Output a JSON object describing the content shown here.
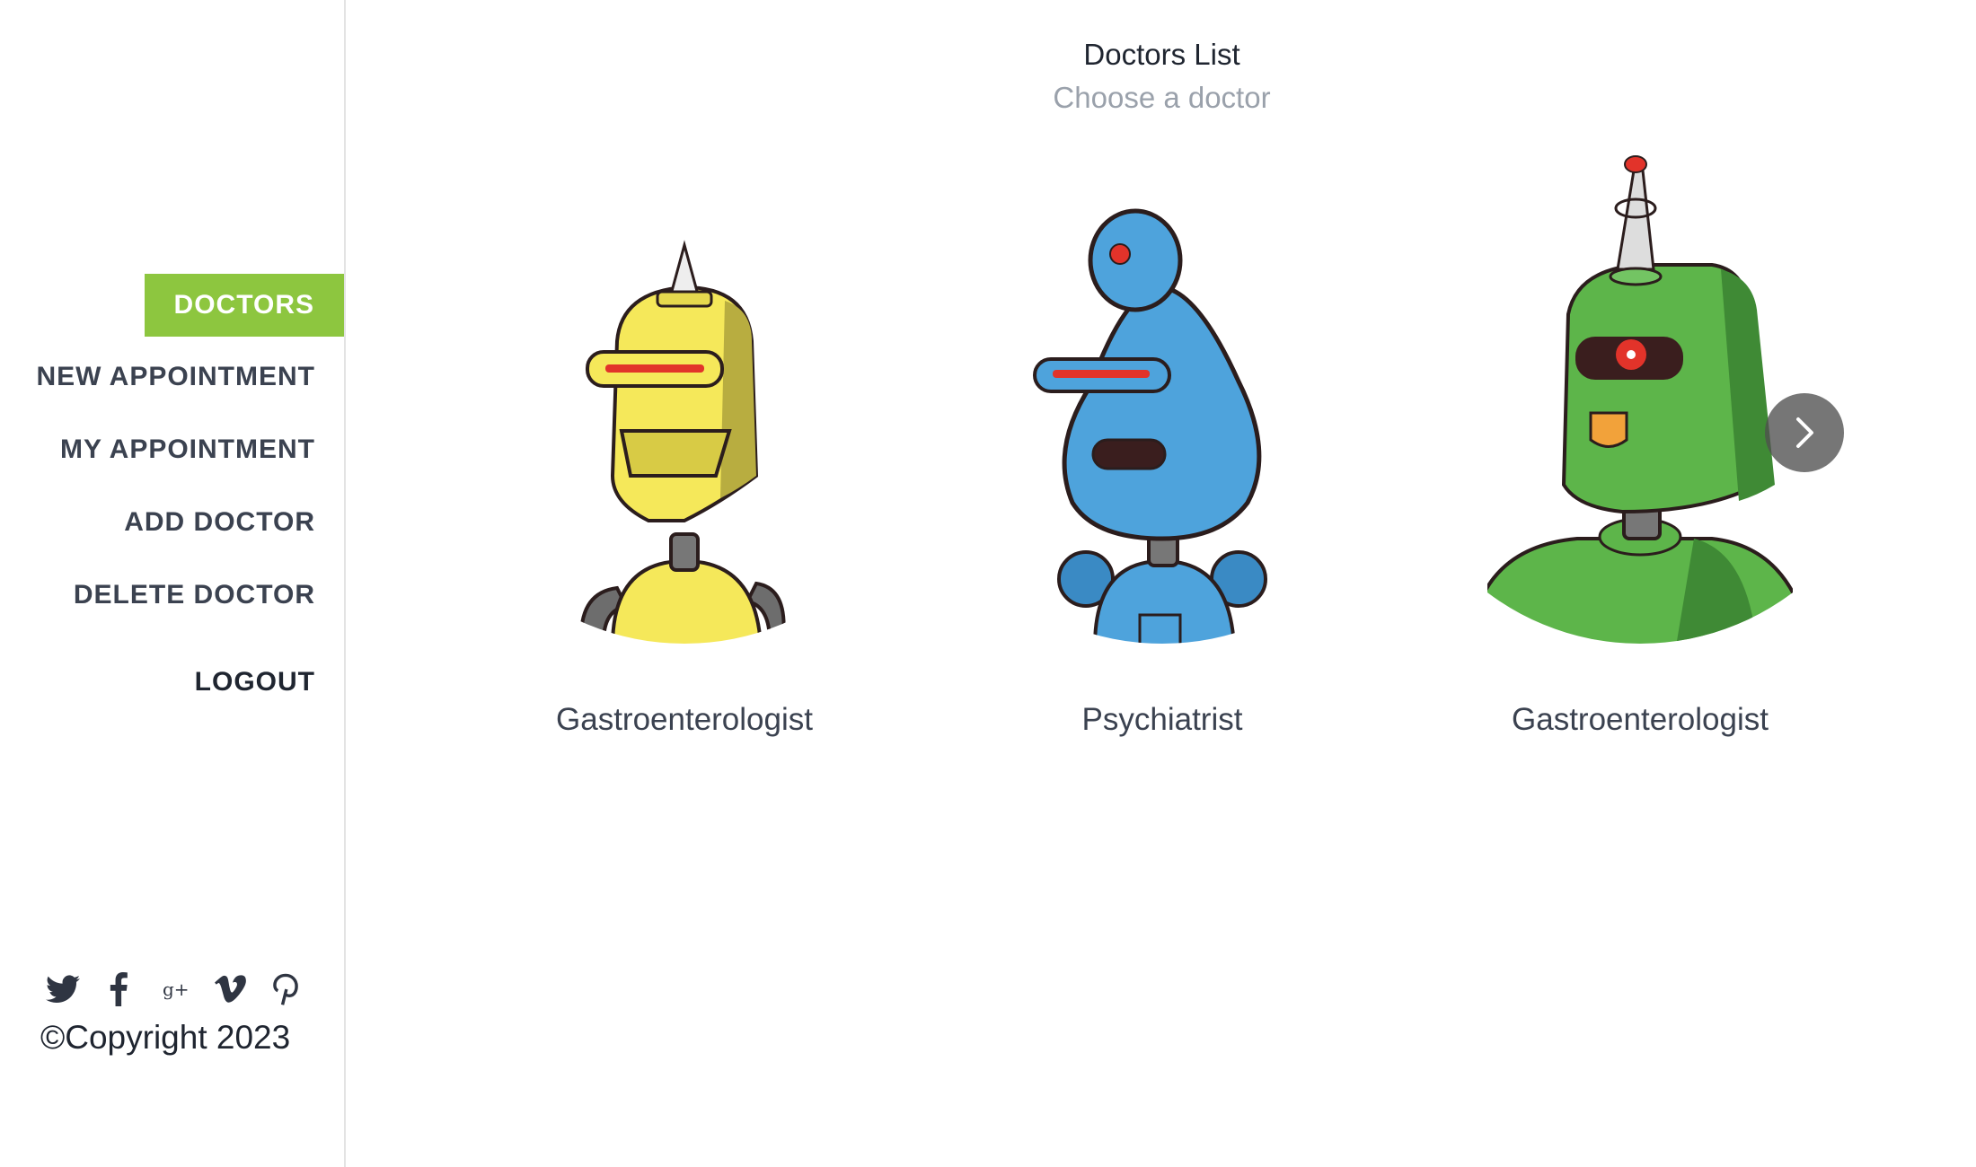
{
  "sidebar": {
    "nav": [
      {
        "label": "DOCTORS",
        "active": true
      },
      {
        "label": "NEW APPOINTMENT",
        "active": false
      },
      {
        "label": "MY APPOINTMENT",
        "active": false
      },
      {
        "label": "ADD DOCTOR",
        "active": false
      },
      {
        "label": "DELETE DOCTOR",
        "active": false
      }
    ],
    "logout_label": "LOGOUT",
    "social_icons": [
      "twitter-icon",
      "facebook-icon",
      "google-plus-icon",
      "vimeo-icon",
      "pinterest-icon"
    ],
    "copyright": "©Copyright 2023",
    "accent_color": "#8dc63f"
  },
  "main": {
    "title": "Doctors List",
    "subtitle": "Choose a doctor",
    "doctors": [
      {
        "specialty": "Gastroenterologist",
        "avatar": "yellow-robot",
        "color": "#f5e85a"
      },
      {
        "specialty": "Psychiatrist",
        "avatar": "blue-robot",
        "color": "#4ea3dc"
      },
      {
        "specialty": "Gastroenterologist",
        "avatar": "green-robot",
        "color": "#5db54a"
      }
    ],
    "next_icon": "chevron-right-icon"
  }
}
